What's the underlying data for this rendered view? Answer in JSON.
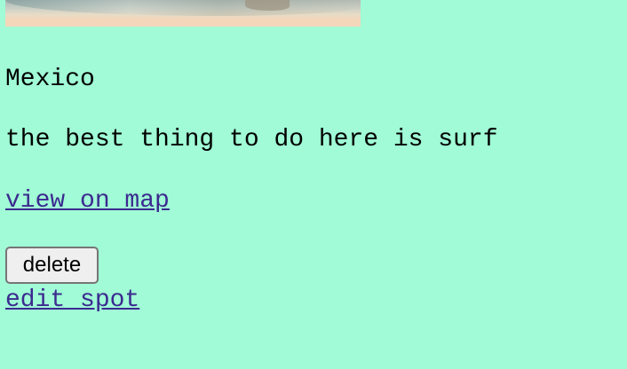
{
  "spot": {
    "image_alt": "beach photo",
    "name": "Mexico",
    "description": "the best thing to do here is surf",
    "map_link": "view on map",
    "delete_label": "delete",
    "edit_link": "edit spot"
  },
  "colors": {
    "background": "#a0fbd6",
    "link": "#3b2a8f"
  }
}
